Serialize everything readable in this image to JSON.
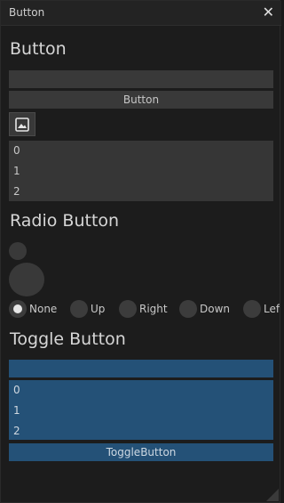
{
  "window": {
    "title": "Button",
    "close_glyph": "✕"
  },
  "button_section": {
    "heading": "Button",
    "empty_button_label": "",
    "button_label": "Button",
    "image_button_icon": "image-icon",
    "list_items": [
      "0",
      "1",
      "2"
    ]
  },
  "radio_section": {
    "heading": "Radio Button",
    "options": [
      {
        "label": "None",
        "selected": true
      },
      {
        "label": "Up",
        "selected": false
      },
      {
        "label": "Right",
        "selected": false
      },
      {
        "label": "Down",
        "selected": false
      },
      {
        "label": "Left",
        "selected": false
      }
    ]
  },
  "toggle_section": {
    "heading": "Toggle Button",
    "empty_toggle_label": "",
    "list_items": [
      "0",
      "1",
      "2"
    ],
    "toggle_button_label": "ToggleButton"
  },
  "colors": {
    "background": "#1c1c1c",
    "button": "#393939",
    "toggle_on": "#245177"
  }
}
